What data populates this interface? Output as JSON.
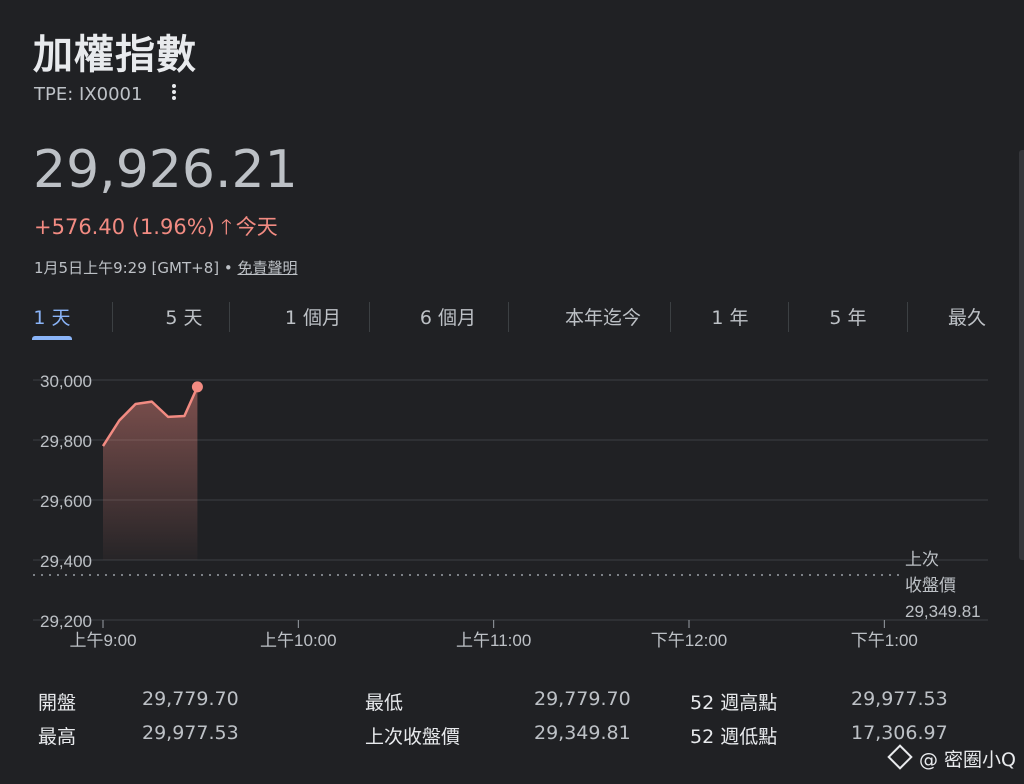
{
  "header": {
    "title": "加權指數",
    "ticker": "TPE: IX0001",
    "price": "29,926.21",
    "change": "+576.40 (1.96%)",
    "change_arrow": "🡑",
    "change_period": "今天",
    "timestamp": "1月5日上午9:29 [GMT+8] •",
    "disclaimer": "免責聲明"
  },
  "tabs": [
    {
      "label": "1 天",
      "active": true
    },
    {
      "label": "5 天"
    },
    {
      "label": "1 個月"
    },
    {
      "label": "6 個月"
    },
    {
      "label": "本年迄今"
    },
    {
      "label": "1 年"
    },
    {
      "label": "5 年"
    },
    {
      "label": "最久"
    }
  ],
  "chart_data": {
    "type": "area",
    "x": [
      "09:00",
      "09:05",
      "09:10",
      "09:15",
      "09:20",
      "09:25",
      "09:29"
    ],
    "values": [
      29779.7,
      29865,
      29920,
      29928,
      29877,
      29880,
      29977
    ],
    "ylim": [
      29200,
      30000
    ],
    "yticks": [
      "30,000",
      "29,800",
      "29,600",
      "29,400",
      "29,200"
    ],
    "yticks_values": [
      30000,
      29800,
      29600,
      29400,
      29200
    ],
    "xticks": [
      "上午9:00",
      "上午10:00",
      "上午11:00",
      "下午12:00",
      "下午1:00"
    ],
    "xrange_minutes": [
      0,
      270
    ],
    "xtick_minutes": [
      0,
      60,
      120,
      180,
      240
    ],
    "prev_close": 29349.81,
    "prev_close_label_line1": "上次",
    "prev_close_label_line2": "收盤價",
    "prev_close_value": "29,349.81",
    "line_color": "#f28b82",
    "grid": true
  },
  "stats": {
    "open_label": "開盤",
    "open_value": "29,779.70",
    "high_label": "最高",
    "high_value": "29,977.53",
    "low_label": "最低",
    "low_value": "29,779.70",
    "prev_close_label": "上次收盤價",
    "prev_close_value": "29,349.81",
    "high52_label": "52 週高點",
    "high52_value": "29,977.53",
    "low52_label": "52 週低點",
    "low52_value": "17,306.97"
  },
  "watermark": "@ 密圈小Q"
}
